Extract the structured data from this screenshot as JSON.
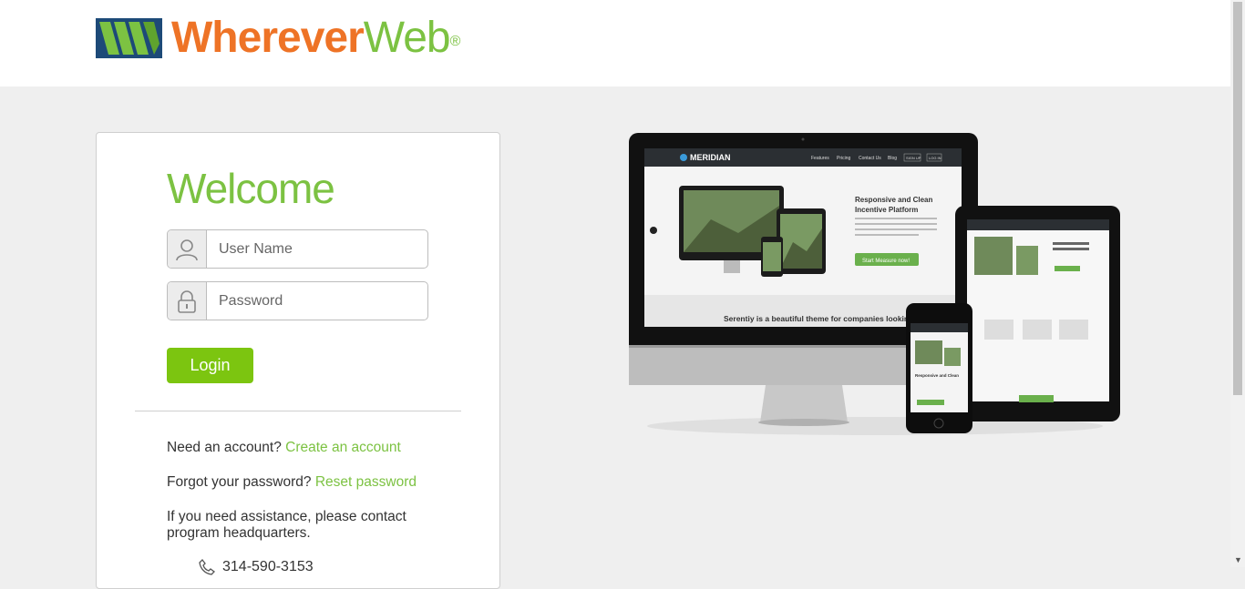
{
  "brand": {
    "name_part1": "Wherever",
    "name_part2": "Web",
    "registered_mark": "®",
    "colors": {
      "orange": "#ee7326",
      "green": "#7cc242",
      "navy": "#1d4a78"
    }
  },
  "login": {
    "title": "Welcome",
    "username_placeholder": "User Name",
    "password_placeholder": "Password",
    "login_label": "Login",
    "button_color": "#7cc510"
  },
  "help": {
    "need_account_text": "Need an account?",
    "create_account_link": "Create an account",
    "forgot_password_text": "Forgot your password?",
    "reset_password_link": "Reset password",
    "assistance_text": "If you need assistance, please contact program headquarters.",
    "phone": "314-590-3153"
  },
  "showcase": {
    "site_name": "MERIDIAN",
    "nav": [
      "Features",
      "Pricing",
      "Contact Us",
      "Blog"
    ],
    "sign_up": "SIGN UP",
    "log_in": "LOG IN",
    "headline": "Responsive and Clean Incentive Platform",
    "cta": "Start Measure now!",
    "tagline": "Serentiy is a beautiful theme for companies looking for a responsive incentive platform",
    "phone_headline": "Responsive and Clean Wrapbootstrap Theme"
  }
}
